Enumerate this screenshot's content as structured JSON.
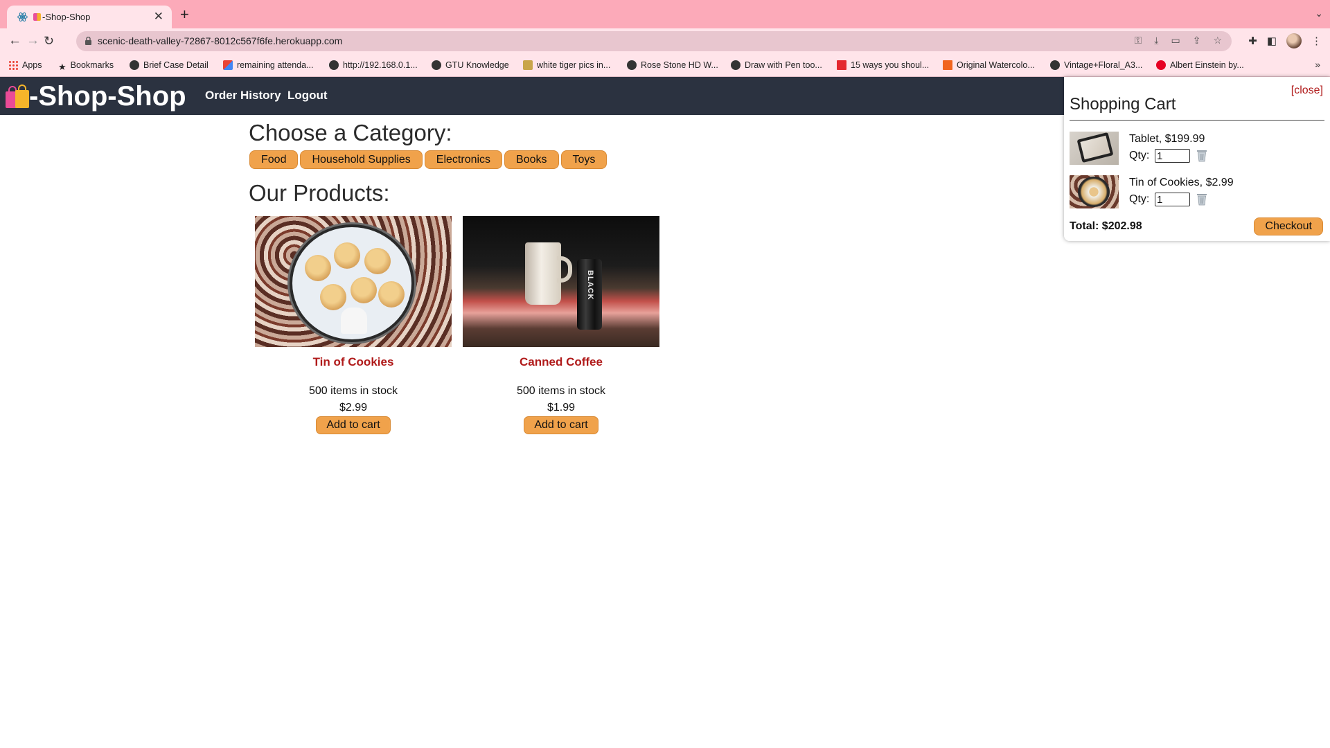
{
  "browser": {
    "tab_title": "-Shop-Shop",
    "url": "scenic-death-valley-72867-8012c567f6fe.herokuapp.com",
    "bookmarks": [
      {
        "label": "Apps",
        "icon": "apps-grid-icon"
      },
      {
        "label": "Bookmarks",
        "icon": "star-icon"
      },
      {
        "label": "Brief Case Detail",
        "icon": "globe-icon"
      },
      {
        "label": "remaining attenda...",
        "icon": "gmail-icon"
      },
      {
        "label": "http://192.168.0.1...",
        "icon": "globe-icon"
      },
      {
        "label": "GTU Knowledge",
        "icon": "globe-icon"
      },
      {
        "label": "white tiger pics in...",
        "icon": "stack-icon"
      },
      {
        "label": "Rose Stone HD W...",
        "icon": "globe-icon"
      },
      {
        "label": "Draw with Pen too...",
        "icon": "globe-icon"
      },
      {
        "label": "15 ways you shoul...",
        "icon": "ta-icon"
      },
      {
        "label": "Original Watercolo...",
        "icon": "etsy-icon"
      },
      {
        "label": "Vintage+Floral_A3...",
        "icon": "globe-icon"
      },
      {
        "label": "Albert Einstein by...",
        "icon": "pinterest-icon"
      }
    ]
  },
  "header": {
    "logo_text": "-Shop-Shop",
    "nav": {
      "order_history": "Order History",
      "logout": "Logout"
    }
  },
  "categories": {
    "title": "Choose a Category:",
    "items": [
      "Food",
      "Household Supplies",
      "Electronics",
      "Books",
      "Toys"
    ]
  },
  "products": {
    "title": "Our Products:",
    "items": [
      {
        "name": "Tin of Cookies",
        "stock": "500 items in stock",
        "price": "$2.99",
        "button": "Add to cart"
      },
      {
        "name": "Canned Coffee",
        "stock": "500 items in stock",
        "price": "$1.99",
        "button": "Add to cart"
      }
    ]
  },
  "cart": {
    "close_label": "[close]",
    "title": "Shopping Cart",
    "qty_label": "Qty:",
    "items": [
      {
        "desc": "Tablet, $199.99",
        "qty": "1"
      },
      {
        "desc": "Tin of Cookies, $2.99",
        "qty": "1"
      }
    ],
    "total": "Total: $202.98",
    "checkout_label": "Checkout"
  },
  "colors": {
    "header_bg": "#2b3240",
    "button_orange": "#f0a24b",
    "product_name_red": "#b01a1a",
    "chrome_pink": "#fcaab9"
  }
}
